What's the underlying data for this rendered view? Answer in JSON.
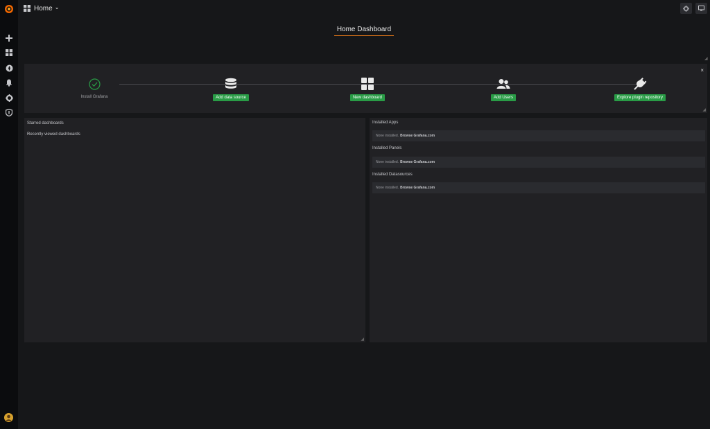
{
  "topbar": {
    "home_label": "Home",
    "dropdown_caret": "⌄"
  },
  "dashboard": {
    "title": "Home Dashboard"
  },
  "getting_started": {
    "close": "×",
    "steps": [
      {
        "type": "label",
        "text": "Install Grafana",
        "icon": "check-circle-icon"
      },
      {
        "type": "button",
        "text": "Add data source",
        "icon": "database-icon"
      },
      {
        "type": "button",
        "text": "New dashboard",
        "icon": "dashboard-grid-icon"
      },
      {
        "type": "button",
        "text": "Add Users",
        "icon": "users-icon"
      },
      {
        "type": "button",
        "text": "Explore plugin repository",
        "icon": "plug-icon"
      }
    ]
  },
  "left_panel": {
    "starred": "Starred dashboards",
    "recent": "Recently viewed dashboards"
  },
  "right_panel": {
    "sections": [
      {
        "heading": "Installed Apps",
        "none_text": "None installed.",
        "link": "Browse Grafana.com"
      },
      {
        "heading": "Installed Panels",
        "none_text": "None installed.",
        "link": "Browse Grafana.com"
      },
      {
        "heading": "Installed Datasources",
        "none_text": "None installed.",
        "link": "Browse Grafana.com"
      }
    ]
  },
  "colors": {
    "accent_green": "#299c46",
    "grafana_orange": "#eb7b18",
    "panel_bg": "#212124",
    "page_bg": "#161719"
  }
}
